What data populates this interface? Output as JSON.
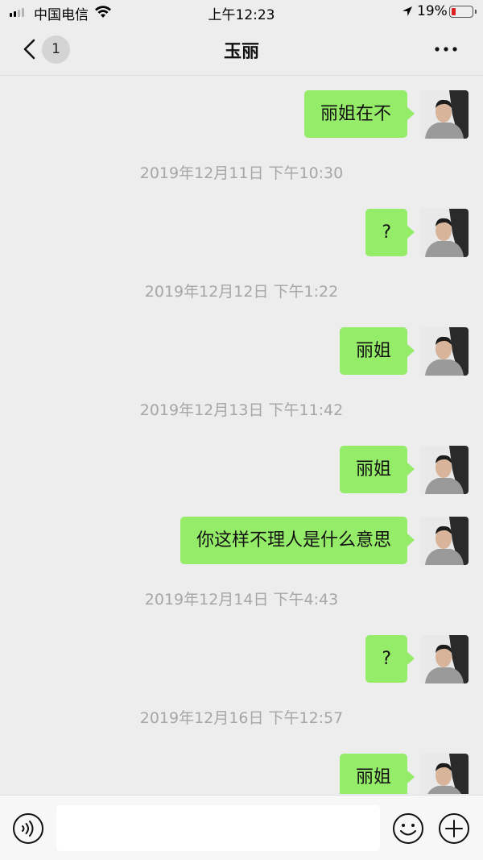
{
  "status_bar": {
    "carrier": "中国电信",
    "time": "上午12:23",
    "battery": "19%",
    "battery_level": 0.19
  },
  "nav": {
    "unread_count": "1",
    "title": "玉丽"
  },
  "messages": [
    {
      "type": "sent",
      "text": "丽姐在不"
    },
    {
      "type": "time",
      "text": "2019年12月11日 下午10:30"
    },
    {
      "type": "sent",
      "text": "?"
    },
    {
      "type": "time",
      "text": "2019年12月12日 下午1:22"
    },
    {
      "type": "sent",
      "text": "丽姐"
    },
    {
      "type": "time",
      "text": "2019年12月13日 下午11:42"
    },
    {
      "type": "sent",
      "text": "丽姐"
    },
    {
      "type": "sent",
      "text": "你这样不理人是什么意思"
    },
    {
      "type": "time",
      "text": "2019年12月14日 下午4:43"
    },
    {
      "type": "sent",
      "text": "?"
    },
    {
      "type": "time",
      "text": "2019年12月16日 下午12:57"
    },
    {
      "type": "sent",
      "text": "丽姐"
    }
  ],
  "input": {
    "placeholder": ""
  },
  "colors": {
    "bubble": "#95ec69",
    "background": "#ededed"
  },
  "icons": {
    "back": "chevron-left-icon",
    "more": "ellipsis-icon",
    "voice": "voice-icon",
    "emoji": "emoji-icon",
    "plus": "plus-icon"
  }
}
